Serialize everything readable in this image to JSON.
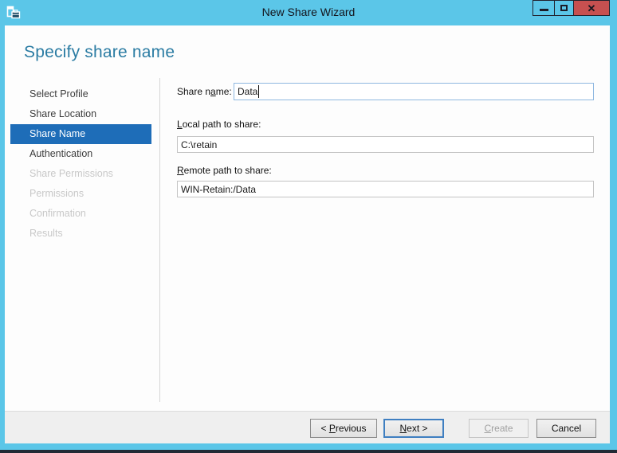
{
  "window": {
    "title": "New Share Wizard",
    "icon": "share-wizard-icon",
    "controls": {
      "minimize": "minimize",
      "maximize": "maximize",
      "close": "close"
    }
  },
  "page": {
    "heading": "Specify share name"
  },
  "sidebar": {
    "items": [
      {
        "label": "Select Profile",
        "state": "enabled"
      },
      {
        "label": "Share Location",
        "state": "enabled"
      },
      {
        "label": "Share Name",
        "state": "selected"
      },
      {
        "label": "Authentication",
        "state": "enabled"
      },
      {
        "label": "Share Permissions",
        "state": "disabled"
      },
      {
        "label": "Permissions",
        "state": "disabled"
      },
      {
        "label": "Confirmation",
        "state": "disabled"
      },
      {
        "label": "Results",
        "state": "disabled"
      }
    ]
  },
  "form": {
    "share_name": {
      "label_pre": "Share n",
      "label_key": "a",
      "label_post": "me:",
      "value": "Data"
    },
    "local_path": {
      "label_pre": "",
      "label_key": "L",
      "label_post": "ocal path to share:",
      "value": "C:\\retain"
    },
    "remote_path": {
      "label_pre": "",
      "label_key": "R",
      "label_post": "emote path to share:",
      "value": "WIN-Retain:/Data"
    }
  },
  "footer": {
    "previous": {
      "pre": "< ",
      "key": "P",
      "post": "revious",
      "state": "enabled"
    },
    "next": {
      "pre": "",
      "key": "N",
      "post": "ext >",
      "state": "default"
    },
    "create": {
      "pre": "",
      "key": "C",
      "post": "reate",
      "state": "disabled"
    },
    "cancel": {
      "label": "Cancel",
      "state": "enabled"
    }
  },
  "colors": {
    "titlebar_blue": "#5bc6e8",
    "close_button_red": "#c75050",
    "heading_blue": "#2b7ca3",
    "selected_item_blue": "#1e6db8",
    "content_background": "#fdfdfd",
    "footer_background": "#efefef"
  }
}
